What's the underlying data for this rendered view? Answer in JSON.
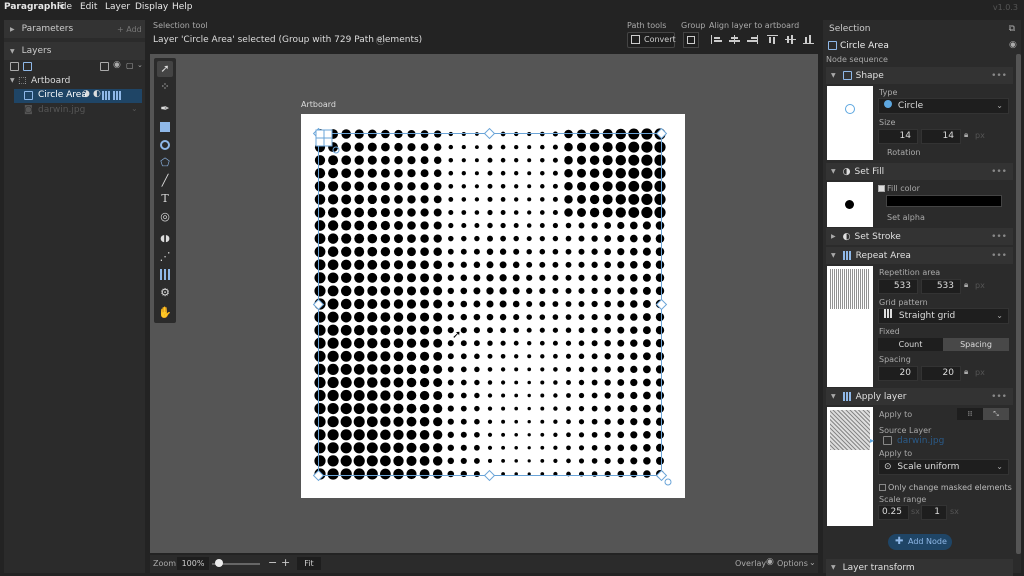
{
  "menubar": {
    "app": "Paragraphic",
    "items": [
      "File",
      "Edit",
      "Layer",
      "Display",
      "Help"
    ],
    "version": "v1.0.3"
  },
  "left": {
    "parameters_title": "Parameters",
    "add_label": "+ Add",
    "layers_title": "Layers",
    "artboard_label": "Artboard",
    "circle_area_label": "Circle Area",
    "darwin_label": "darwin.jpg"
  },
  "toolheader": {
    "tool_name": "Selection tool",
    "status": "Layer 'Circle Area' selected (Group with 729 Path elements)",
    "path_tools": "Path tools",
    "convert": "Convert",
    "group": "Group",
    "align": "Align layer to artboard"
  },
  "canvas": {
    "artboard_label": "Artboard",
    "grid_count": 27,
    "dots_color": "#000000"
  },
  "bottom": {
    "zoom_label": "Zoom",
    "zoom_value": "100%",
    "zoom_level": 0.15,
    "fit": "Fit",
    "overlay": "Overlay",
    "options": "Options"
  },
  "right": {
    "selection_title": "Selection",
    "layer_name": "Circle Area",
    "node_sequence": "Node sequence",
    "shape": {
      "title": "Shape",
      "type_label": "Type",
      "type_value": "Circle",
      "size_label": "Size",
      "w": "14",
      "h": "14",
      "unit": "px",
      "rotation": "Rotation"
    },
    "fill": {
      "title": "Set Fill",
      "fill_color_label": "Fill color",
      "fill_color": "#000000",
      "set_alpha": "Set alpha"
    },
    "stroke": {
      "title": "Set Stroke"
    },
    "repeat": {
      "title": "Repeat Area",
      "rep_area_label": "Repetition area",
      "w": "533",
      "h": "533",
      "unit": "px",
      "grid_pattern_label": "Grid pattern",
      "grid_pattern": "Straight grid",
      "fixed_label": "Fixed",
      "count": "Count",
      "spacing_btn": "Spacing",
      "spacing_label": "Spacing",
      "sx": "20",
      "sy": "20"
    },
    "apply": {
      "title": "Apply layer",
      "apply_to_label": "Apply to",
      "source_layer_label": "Source Layer",
      "source_layer": "darwin.jpg",
      "apply_to2_label": "Apply to",
      "apply_to2": "Scale uniform",
      "only_masked": "Only change masked elements",
      "scale_range_label": "Scale range",
      "min": "0.25",
      "max": "1",
      "min_unit": "sx",
      "max_unit": "sx"
    },
    "add_node": "Add Node",
    "layer_transform": "Layer transform"
  }
}
